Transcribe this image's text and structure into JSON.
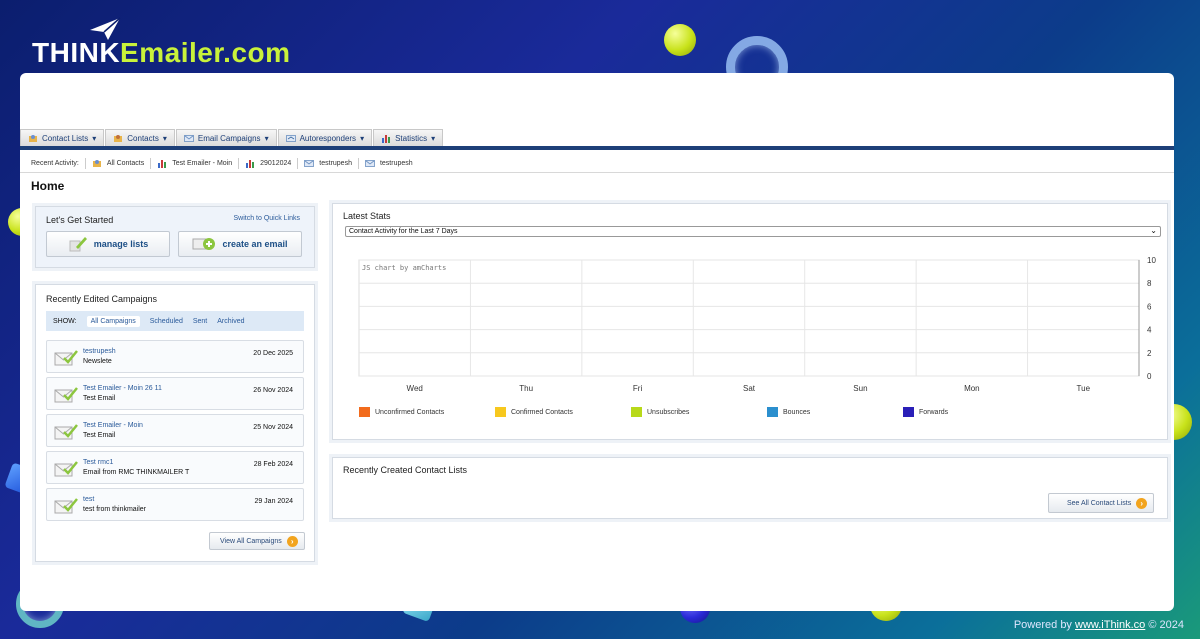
{
  "brand": {
    "think": "THINK",
    "emailer": "Emailer.com"
  },
  "footer": {
    "powered_prefix": "Powered by ",
    "link": "www.iThink.co",
    "suffix": " © 2024"
  },
  "menu": {
    "tabs": [
      {
        "label": "Contact Lists",
        "icon": "contact-lists-icon"
      },
      {
        "label": "Contacts",
        "icon": "contacts-icon"
      },
      {
        "label": "Email Campaigns",
        "icon": "email-icon"
      },
      {
        "label": "Autoresponders",
        "icon": "autoresponder-icon"
      },
      {
        "label": "Statistics",
        "icon": "statistics-icon"
      }
    ],
    "chevron": "▾"
  },
  "recent_activity": {
    "label": "Recent Activity:",
    "items": [
      {
        "label": "All Contacts",
        "icon": "contact-lists-icon"
      },
      {
        "label": "Test Emailer - Moin",
        "icon": "statistics-icon"
      },
      {
        "label": "29012024",
        "icon": "statistics-icon"
      },
      {
        "label": "testrupesh",
        "icon": "email-icon"
      },
      {
        "label": "testrupesh",
        "icon": "email-icon"
      }
    ]
  },
  "page_title": "Home",
  "get_started": {
    "title": "Let's Get Started",
    "switch_link": "Switch to Quick Links",
    "manage_lists": "manage lists",
    "create_email": "create an email"
  },
  "campaigns": {
    "title": "Recently Edited Campaigns",
    "show_label": "SHOW:",
    "filters": [
      "All Campaigns",
      "Scheduled",
      "Sent",
      "Archived"
    ],
    "items": [
      {
        "name": "testrupesh",
        "subject": "Newslete",
        "date": "20 Dec 2025"
      },
      {
        "name": "Test Emailer - Moin 26 11",
        "subject": "Test Email",
        "date": "26 Nov 2024"
      },
      {
        "name": "Test Emailer - Moin",
        "subject": "Test Email",
        "date": "25 Nov 2024"
      },
      {
        "name": "Test rmc1",
        "subject": "Email from RMC THINKMAILER T",
        "date": "28 Feb 2024"
      },
      {
        "name": "test",
        "subject": "test from thinkmailer",
        "date": "29 Jan 2024"
      }
    ],
    "view_all": "View All Campaigns"
  },
  "latest_stats": {
    "title": "Latest Stats",
    "select_value": "Contact Activity for the Last 7 Days",
    "chart_credit": "JS chart by amCharts"
  },
  "chart_data": {
    "type": "bar",
    "categories": [
      "Wed",
      "Thu",
      "Fri",
      "Sat",
      "Sun",
      "Mon",
      "Tue"
    ],
    "series": [
      {
        "name": "Unconfirmed Contacts",
        "color": "#f26b1d",
        "values": [
          0,
          0,
          0,
          0,
          0,
          0,
          0
        ]
      },
      {
        "name": "Confirmed Contacts",
        "color": "#f7c81e",
        "values": [
          0,
          0,
          0,
          0,
          0,
          0,
          0
        ]
      },
      {
        "name": "Unsubscribes",
        "color": "#b8d91a",
        "values": [
          0,
          0,
          0,
          0,
          0,
          0,
          0
        ]
      },
      {
        "name": "Bounces",
        "color": "#2b8fce",
        "values": [
          0,
          0,
          0,
          0,
          0,
          0,
          0
        ]
      },
      {
        "name": "Forwards",
        "color": "#2a1fb8",
        "values": [
          0,
          0,
          0,
          0,
          0,
          0,
          0
        ]
      }
    ],
    "yticks": [
      "10",
      "8",
      "6",
      "4",
      "2",
      "0"
    ],
    "ylim": [
      0,
      10
    ],
    "grid": true,
    "legend_position": "bottom"
  },
  "contact_lists": {
    "title": "Recently Created Contact Lists",
    "see_all": "See All Contact Lists"
  }
}
